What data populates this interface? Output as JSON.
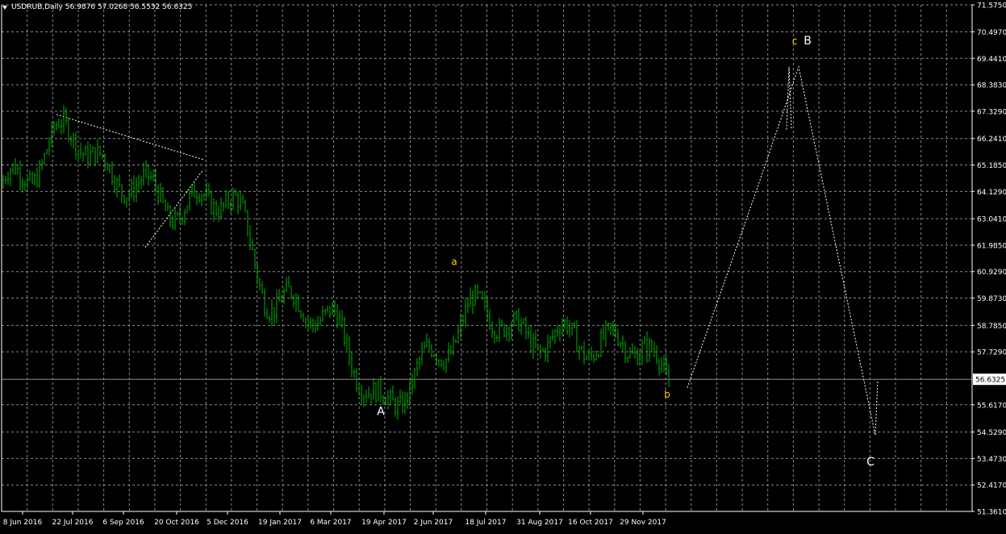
{
  "header": {
    "symbol": "USDRUB,Daily",
    "quote": "56.9876 57.0268 56.5532 56.6325"
  },
  "colors": {
    "background": "#000000",
    "candles": "#00b400",
    "grid": "#8a8a8a",
    "axis_text": "#ffffff",
    "current_price_line": "#8c8c8c",
    "wave_labels_major": "#ffffff",
    "wave_labels_minor": "#ffd400",
    "trendlines": "#ffffff"
  },
  "chart_data": {
    "type": "candlestick",
    "title": "USDRUB,Daily",
    "xlabel": "",
    "ylabel": "",
    "ylim": [
      51.361,
      71.575
    ],
    "grid": true,
    "y_ticks": [
      "71.5750",
      "70.4970",
      "69.4410",
      "68.3830",
      "67.3290",
      "66.2410",
      "65.1850",
      "64.1290",
      "63.0410",
      "61.9850",
      "60.9290",
      "59.8730",
      "58.7850",
      "57.7290",
      "56.6325",
      "55.6170",
      "54.5290",
      "53.4730",
      "52.4170",
      "51.3610"
    ],
    "x_ticks": [
      "8 Jun 2016",
      "22 Jul 2016",
      "6 Sep 2016",
      "20 Oct 2016",
      "5 Dec 2016",
      "19 Jan 2017",
      "6 Mar 2017",
      "19 Apr 2017",
      "2 Jun 2017",
      "18 Jul 2017",
      "31 Aug 2017",
      "16 Oct 2017",
      "29 Nov 2017"
    ],
    "current_price": 56.6325,
    "close_path": [
      {
        "date": "8 Jun 2016",
        "close": 64.3
      },
      {
        "date": "22 Jul 2016",
        "close": 66.6
      },
      {
        "date": "6 Sep 2016",
        "close": 64.8
      },
      {
        "date": "20 Oct 2016",
        "close": 63.0
      },
      {
        "date": "5 Dec 2016",
        "close": 64.3
      },
      {
        "date": "19 Jan 2017",
        "close": 59.4
      },
      {
        "date": "6 Mar 2017",
        "close": 58.7
      },
      {
        "date": "19 Apr 2017",
        "close": 56.0
      },
      {
        "date": "2 Jun 2017",
        "close": 57.1
      },
      {
        "date": "18 Jul 2017",
        "close": 59.6
      },
      {
        "date": "31 Aug 2017",
        "close": 58.4
      },
      {
        "date": "16 Oct 2017",
        "close": 57.6
      },
      {
        "date": "29 Nov 2017",
        "close": 58.5
      }
    ],
    "wave_labels": [
      {
        "text": "A",
        "style": "major",
        "x": "19 Apr 2017",
        "y": 55.2
      },
      {
        "text": "a",
        "style": "minor",
        "x": "2 Jun 2017",
        "y": 61.2
      },
      {
        "text": "b",
        "style": "minor",
        "x": "29 Nov 2017",
        "y": 55.9
      },
      {
        "text": "c",
        "style": "minor",
        "x": "",
        "y": 70.0
      },
      {
        "text": "B",
        "style": "major",
        "x": "",
        "y": 70.0
      },
      {
        "text": "C",
        "style": "major",
        "x": "",
        "y": 53.2
      }
    ],
    "annotations": {
      "projection_path": [
        {
          "x": "",
          "y": 56.3
        },
        {
          "x": "",
          "y": 64.2
        },
        {
          "x": "",
          "y": 69.1
        },
        {
          "x": "",
          "y": 54.4
        },
        {
          "x": "",
          "y": 56.6
        }
      ]
    }
  }
}
